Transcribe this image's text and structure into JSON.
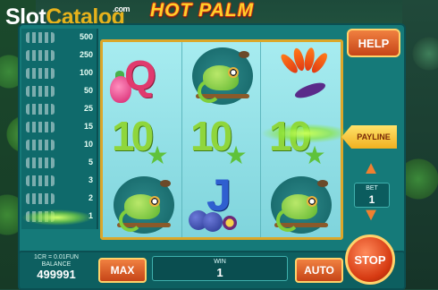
{
  "brand": {
    "slot": "Slot",
    "catalog": "Catalog",
    "com": ".com"
  },
  "game": {
    "title": "HOT PALM"
  },
  "paytable": [
    {
      "value": "500"
    },
    {
      "value": "250"
    },
    {
      "value": "100"
    },
    {
      "value": "50"
    },
    {
      "value": "25"
    },
    {
      "value": "15"
    },
    {
      "value": "10"
    },
    {
      "value": "5"
    },
    {
      "value": "3"
    },
    {
      "value": "2"
    },
    {
      "value": "1"
    }
  ],
  "reels": {
    "symbols": [
      [
        "Q / dragon fruit",
        "10 / star fruit",
        "chameleon"
      ],
      [
        "chameleon",
        "10 / star fruit",
        "J / plums"
      ],
      [
        "bird of paradise flower",
        "10 / star fruit",
        "chameleon"
      ]
    ]
  },
  "controls": {
    "help": "HELP",
    "payline": "PAYLINE",
    "bet_label": "BET",
    "bet_value": "1",
    "max": "MAX",
    "auto": "AUTO",
    "stop": "STOP",
    "win_label": "WIN",
    "win_value": "1"
  },
  "info": {
    "cr": "1CR = 0.01FUN",
    "balance_label": "BALANCE",
    "balance": "499991"
  },
  "colors": {
    "frame": "#157a79",
    "button": "#d85a22",
    "title": "#ffcf2a",
    "payline_glow": "#b8ff4a"
  }
}
